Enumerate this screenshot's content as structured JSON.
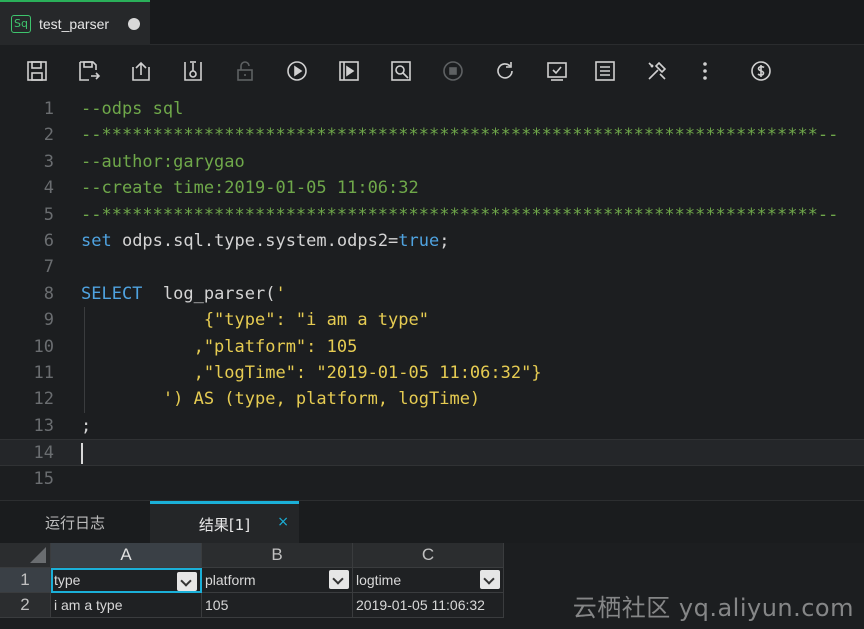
{
  "tab": {
    "icon_label": "Sq",
    "title": "test_parser"
  },
  "toolbar": {
    "buttons": [
      "save-icon",
      "save-as-icon",
      "upload-icon",
      "commit-icon",
      "lock-icon",
      "run-icon",
      "run-with-params-icon",
      "cost-check-icon",
      "stop-icon",
      "refresh-icon",
      "format-check-icon",
      "log-icon",
      "tools-icon",
      "more-icon",
      "cost-estimate-icon"
    ]
  },
  "editor": {
    "line_numbers": [
      "1",
      "2",
      "3",
      "4",
      "5",
      "6",
      "7",
      "8",
      "9",
      "10",
      "11",
      "12",
      "13",
      "14",
      "15"
    ],
    "lines": [
      [
        {
          "t": "--odps sql",
          "c": "com"
        }
      ],
      [
        {
          "t": "--**********************************************************************--",
          "c": "com"
        }
      ],
      [
        {
          "t": "--author:garygao",
          "c": "com"
        }
      ],
      [
        {
          "t": "--create time:2019-01-05 11:06:32",
          "c": "com"
        }
      ],
      [
        {
          "t": "--**********************************************************************--",
          "c": "com"
        }
      ],
      [
        {
          "t": "set",
          "c": "kw"
        },
        {
          "t": " odps.sql.type.system.odps2=",
          "c": "txt"
        },
        {
          "t": "true",
          "c": "kw"
        },
        {
          "t": ";",
          "c": "txt"
        }
      ],
      [],
      [
        {
          "t": "SELECT",
          "c": "kw"
        },
        {
          "t": "  log_parser(",
          "c": "txt"
        },
        {
          "t": "'",
          "c": "str"
        }
      ],
      [
        {
          "t": "            {\"type\": \"i am a type\"",
          "c": "str"
        }
      ],
      [
        {
          "t": "           ,\"platform\": 105",
          "c": "str"
        }
      ],
      [
        {
          "t": "           ,\"logTime\": \"2019-01-05 11:06:32\"}",
          "c": "str"
        }
      ],
      [
        {
          "t": "        ') AS (type, platform, logTime)",
          "c": "str"
        }
      ],
      [
        {
          "t": ";",
          "c": "txt"
        }
      ],
      [],
      []
    ]
  },
  "bottom": {
    "log_tab": "运行日志",
    "result_tab": "结果[1]",
    "close": "×"
  },
  "grid": {
    "columns": [
      "A",
      "B",
      "C"
    ],
    "row_numbers": [
      "1",
      "2"
    ],
    "header_row": [
      "type",
      "platform",
      "logtime"
    ],
    "data_row": [
      "i am a type",
      "105",
      "2019-01-05 11:06:32"
    ]
  },
  "watermark": "云栖社区 yq.aliyun.com"
}
